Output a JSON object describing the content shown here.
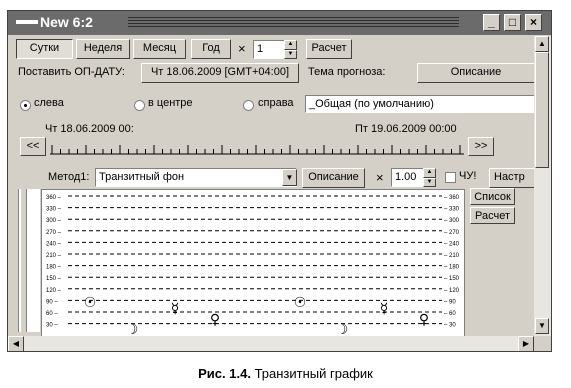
{
  "window": {
    "title": "New 6:2"
  },
  "toolbar": {
    "period_tabs": [
      "Сутки",
      "Неделя",
      "Месяц",
      "Год"
    ],
    "multiply_sign": "×",
    "count_value": "1",
    "calc_label": "Расчет"
  },
  "date_row": {
    "label": "Поставить ОП-ДАТУ:",
    "date_value": "Чт 18.06.2009 [GMT+04:00]",
    "topic_label": "Тема прогноза:",
    "description_label": "Описание",
    "topic_value": "_Общая (по умолчанию)"
  },
  "radios": [
    {
      "label": "слева",
      "checked": true
    },
    {
      "label": "в центре",
      "checked": false
    },
    {
      "label": "справа",
      "checked": false
    }
  ],
  "timeline": {
    "start_label": "Чт 18.06.2009 00:",
    "end_label": "Пт 19.06.2009 00:00",
    "prev_label": "<<",
    "next_label": ">>"
  },
  "method_row": {
    "label": "Метод1:",
    "method_value": "Транзитный фон",
    "description_label": "Описание",
    "multiply_sign": "×",
    "factor_value": "1.00",
    "checkbox_label": "ЧУ!",
    "settings_label": "Настр",
    "list_label": "Список",
    "calc_label": "Расчет"
  },
  "graph": {
    "y_ticks": [
      "360",
      "330",
      "300",
      "270",
      "240",
      "210",
      "180",
      "150",
      "120",
      "90",
      "60",
      "30"
    ],
    "planet_symbols": [
      "☉",
      "☿",
      "♀",
      "☉",
      "☿",
      "♀",
      "☽",
      "☽"
    ]
  },
  "caption": {
    "figure_num": "Рис. 1.4.",
    "text": "Транзитный график"
  }
}
